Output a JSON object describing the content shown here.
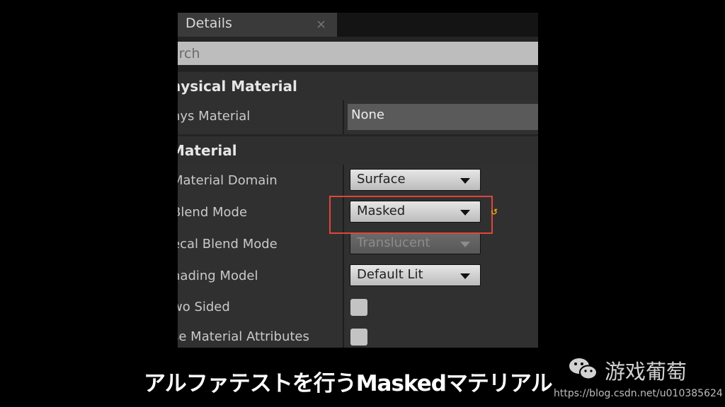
{
  "panel": {
    "tab_title": "Details",
    "tab_close": "×",
    "search_placeholder": "arch"
  },
  "sections": {
    "physical": {
      "title": "hysical Material",
      "phys_material_label": "hys Material",
      "phys_material_value": "None"
    },
    "material": {
      "title": "Material",
      "domain_label": "Material Domain",
      "domain_value": "Surface",
      "blend_label": "Blend Mode",
      "blend_value": "Masked",
      "decal_label": "ecal Blend Mode",
      "decal_value": "Translucent",
      "shading_label": "hading Model",
      "shading_value": "Default Lit",
      "two_sided_label": "wo Sided",
      "use_attr_label": "se Material Attributes"
    }
  },
  "overlay": {
    "caption": "アルファテストを行うMaskedマテリアル",
    "brand": "游戏葡萄",
    "url": "https://blog.csdn.net/u010385624",
    "highlight_color": "#e2443c",
    "reset_icon_color": "#e5a81c"
  }
}
